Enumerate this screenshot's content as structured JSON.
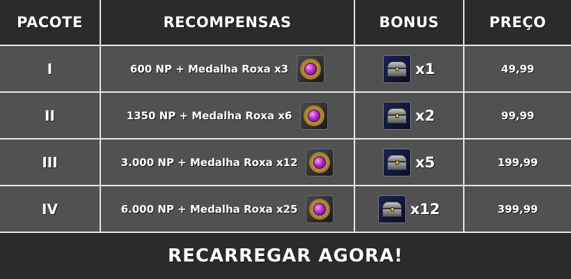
{
  "headers": {
    "package": "PACOTE",
    "rewards": "RECOMPENSAS",
    "bonus": "BONUS",
    "price": "PREÇO"
  },
  "rows": [
    {
      "tier": "I",
      "reward": "600 NP + Medalha Roxa x3",
      "bonus_qty": "x1",
      "price": "49,99",
      "reward_icon": "purple-medal-icon",
      "bonus_icon": "chest-icon"
    },
    {
      "tier": "II",
      "reward": "1350 NP + Medalha Roxa x6",
      "bonus_qty": "x2",
      "price": "99,99",
      "reward_icon": "purple-medal-icon",
      "bonus_icon": "chest-icon"
    },
    {
      "tier": "III",
      "reward": "3.000 NP + Medalha Roxa x12",
      "bonus_qty": "x5",
      "price": "199,99",
      "reward_icon": "purple-medal-icon",
      "bonus_icon": "chest-icon"
    },
    {
      "tier": "IV",
      "reward": "6.000 NP + Medalha Roxa x25",
      "bonus_qty": "x12",
      "price": "399,99",
      "reward_icon": "purple-medal-icon",
      "bonus_icon": "chest-icon"
    }
  ],
  "cta": {
    "label": "RECARREGAR AGORA!"
  },
  "colors": {
    "header_bg": "#2b2b2b",
    "row_bg": "#515151",
    "grid_lines": "#e9e9e9",
    "text": "#ffffff"
  }
}
